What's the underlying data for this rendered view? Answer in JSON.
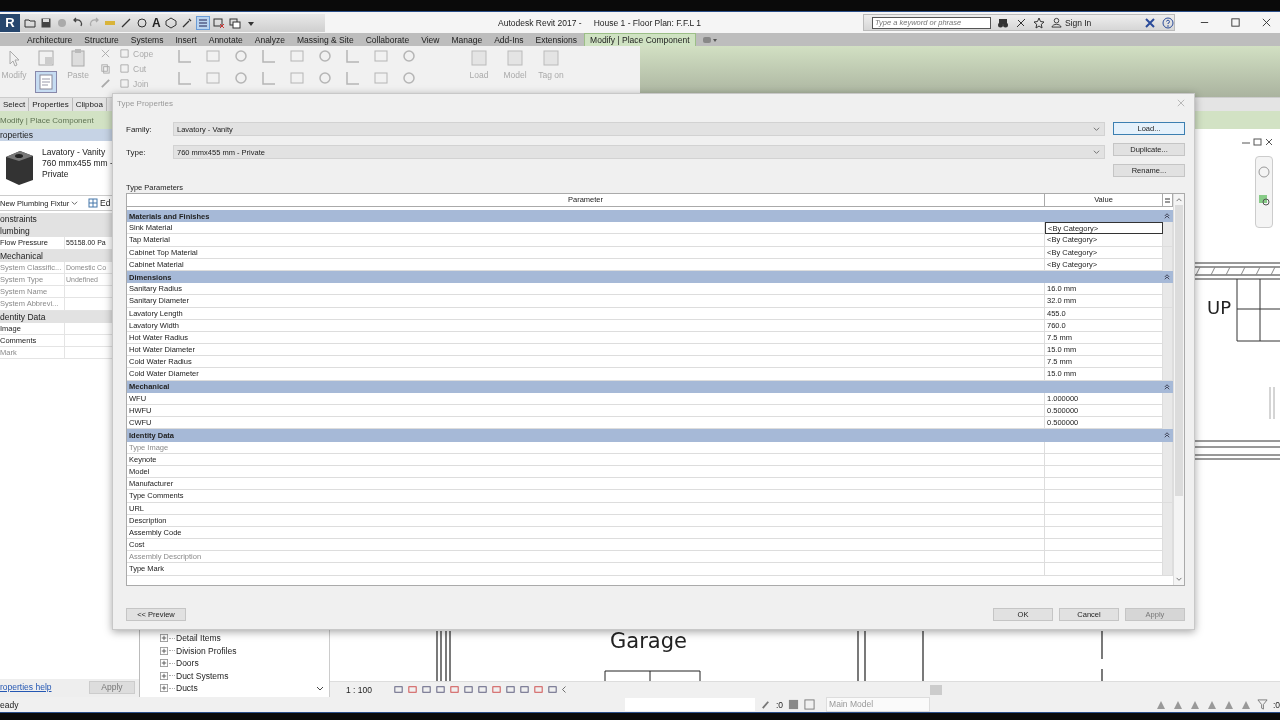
{
  "window": {
    "app_title": "Autodesk Revit 2017 -",
    "doc_title": "House 1 - Floor Plan: F.F.L 1"
  },
  "app_button": "R",
  "qat_text_tool": "A",
  "help_search": {
    "placeholder": "Type a keyword or phrase"
  },
  "sign_in": "Sign In",
  "ribbon_tabs": [
    {
      "label": "Architecture",
      "selected": false
    },
    {
      "label": "Structure",
      "selected": false
    },
    {
      "label": "Systems",
      "selected": false
    },
    {
      "label": "Insert",
      "selected": false
    },
    {
      "label": "Annotate",
      "selected": false
    },
    {
      "label": "Analyze",
      "selected": false
    },
    {
      "label": "Massing & Site",
      "selected": false
    },
    {
      "label": "Collaborate",
      "selected": false
    },
    {
      "label": "View",
      "selected": false
    },
    {
      "label": "Manage",
      "selected": false
    },
    {
      "label": "Add-Ins",
      "selected": false
    },
    {
      "label": "Extensions",
      "selected": false
    },
    {
      "label": "Modify | Place Component",
      "selected": true
    }
  ],
  "ribbon_tools": {
    "modify": "Modify",
    "paste": "Paste",
    "edit": [
      "Cope",
      "Cut",
      "Join"
    ],
    "family": [
      "Load",
      "Model",
      "Tag on"
    ]
  },
  "panel_labels": [
    "Select",
    "Properties",
    "Clipboa"
  ],
  "option_bar": "Modify | Place Component",
  "properties": {
    "header": "roperties",
    "type_lines": [
      "Lavatory - Vanity",
      "760 mmx455 mm -",
      "Private"
    ],
    "instance_filter": "New Plumbing Fixtur",
    "edit_type": "Ed",
    "rows": [
      {
        "kind": "group",
        "label": "onstraints"
      },
      {
        "kind": "group",
        "label": "lumbing"
      },
      {
        "kind": "param",
        "label": "Flow Pressure",
        "value": "55158.00 Pa",
        "disabled": false
      },
      {
        "kind": "group",
        "label": "Mechanical"
      },
      {
        "kind": "param",
        "label": "System Classific...",
        "value": "Domestic Co",
        "disabled": true
      },
      {
        "kind": "param",
        "label": "System Type",
        "value": "Undefined",
        "disabled": true
      },
      {
        "kind": "param",
        "label": "System Name",
        "disabled": true
      },
      {
        "kind": "param",
        "label": "System Abbrevi...",
        "disabled": true
      },
      {
        "kind": "group",
        "label": "dentity Data"
      },
      {
        "kind": "param",
        "label": "Image",
        "disabled": false
      },
      {
        "kind": "param",
        "label": "Comments",
        "disabled": false
      },
      {
        "kind": "param",
        "label": "Mark",
        "disabled": true
      }
    ],
    "help_link": "roperties help",
    "apply": {
      "label": "Apply",
      "disabled": true
    }
  },
  "project_browser": [
    "Detail Items",
    "Division Profiles",
    "Doors",
    "Duct Systems",
    "Ducts"
  ],
  "view_scale": "1 : 100",
  "canvas_labels": {
    "room": "Garage",
    "stair": "UP"
  },
  "status_bar": {
    "message": "eady",
    "select_count": ":0",
    "model": "Main Model",
    "filter_count": ":0"
  },
  "dialog": {
    "title": "Type Properties",
    "family_label": "Family:",
    "family": "Lavatory - Vanity",
    "type_label": "Type:",
    "type": "760 mmx455 mm - Private",
    "side_buttons": [
      {
        "label": "Load...",
        "hovered": true
      },
      {
        "label": "Duplicate...",
        "hovered": false
      },
      {
        "label": "Rename...",
        "hovered": false
      }
    ],
    "section": "Type Parameters",
    "columns": [
      "Parameter",
      "Value"
    ],
    "groups": [
      {
        "name": "Materials and Finishes",
        "rows": [
          {
            "name": "Sink Material",
            "value": "<By Category>",
            "disabled": false,
            "selected": true
          },
          {
            "name": "Tap Material",
            "value": "<By Category>",
            "disabled": false,
            "selected": false
          },
          {
            "name": "Cabinet Top Material",
            "value": "<By Category>",
            "disabled": false,
            "selected": false
          },
          {
            "name": "Cabinet Material",
            "value": "<By Category>",
            "disabled": false,
            "selected": false
          }
        ]
      },
      {
        "name": "Dimensions",
        "rows": [
          {
            "name": "Sanitary Radius",
            "value": "16.0 mm",
            "disabled": false,
            "selected": false
          },
          {
            "name": "Sanitary Diameter",
            "value": "32.0 mm",
            "disabled": false,
            "selected": false
          },
          {
            "name": "Lavatory Length",
            "value": "455.0",
            "disabled": false,
            "selected": false
          },
          {
            "name": "Lavatory Width",
            "value": "760.0",
            "disabled": false,
            "selected": false
          },
          {
            "name": "Hot Water Radius",
            "value": "7.5 mm",
            "disabled": false,
            "selected": false
          },
          {
            "name": "Hot Water Diameter",
            "value": "15.0 mm",
            "disabled": false,
            "selected": false
          },
          {
            "name": "Cold Water Radius",
            "value": "7.5 mm",
            "disabled": false,
            "selected": false
          },
          {
            "name": "Cold Water Diameter",
            "value": "15.0 mm",
            "disabled": false,
            "selected": false
          }
        ]
      },
      {
        "name": "Mechanical",
        "rows": [
          {
            "name": "WFU",
            "value": "1.000000",
            "disabled": false,
            "selected": false
          },
          {
            "name": "HWFU",
            "value": "0.500000",
            "disabled": false,
            "selected": false
          },
          {
            "name": "CWFU",
            "value": "0.500000",
            "disabled": false,
            "selected": false
          }
        ]
      },
      {
        "name": "Identity Data",
        "rows": [
          {
            "name": "Type Image",
            "disabled": true,
            "selected": false
          },
          {
            "name": "Keynote",
            "disabled": false,
            "selected": false
          },
          {
            "name": "Model",
            "disabled": false,
            "selected": false
          },
          {
            "name": "Manufacturer",
            "disabled": false,
            "selected": false
          },
          {
            "name": "Type Comments",
            "disabled": false,
            "selected": false
          },
          {
            "name": "URL",
            "disabled": false,
            "selected": false
          },
          {
            "name": "Description",
            "disabled": false,
            "selected": false
          },
          {
            "name": "Assembly Code",
            "disabled": false,
            "selected": false
          },
          {
            "name": "Cost",
            "disabled": false,
            "selected": false
          },
          {
            "name": "Assembly Description",
            "disabled": true,
            "selected": false
          },
          {
            "name": "Type Mark",
            "disabled": false,
            "selected": false
          }
        ]
      }
    ],
    "preview": "<< Preview",
    "footer_buttons": [
      {
        "label": "OK",
        "disabled": false
      },
      {
        "label": "Cancel",
        "disabled": false
      },
      {
        "label": "Apply",
        "disabled": true
      }
    ]
  }
}
